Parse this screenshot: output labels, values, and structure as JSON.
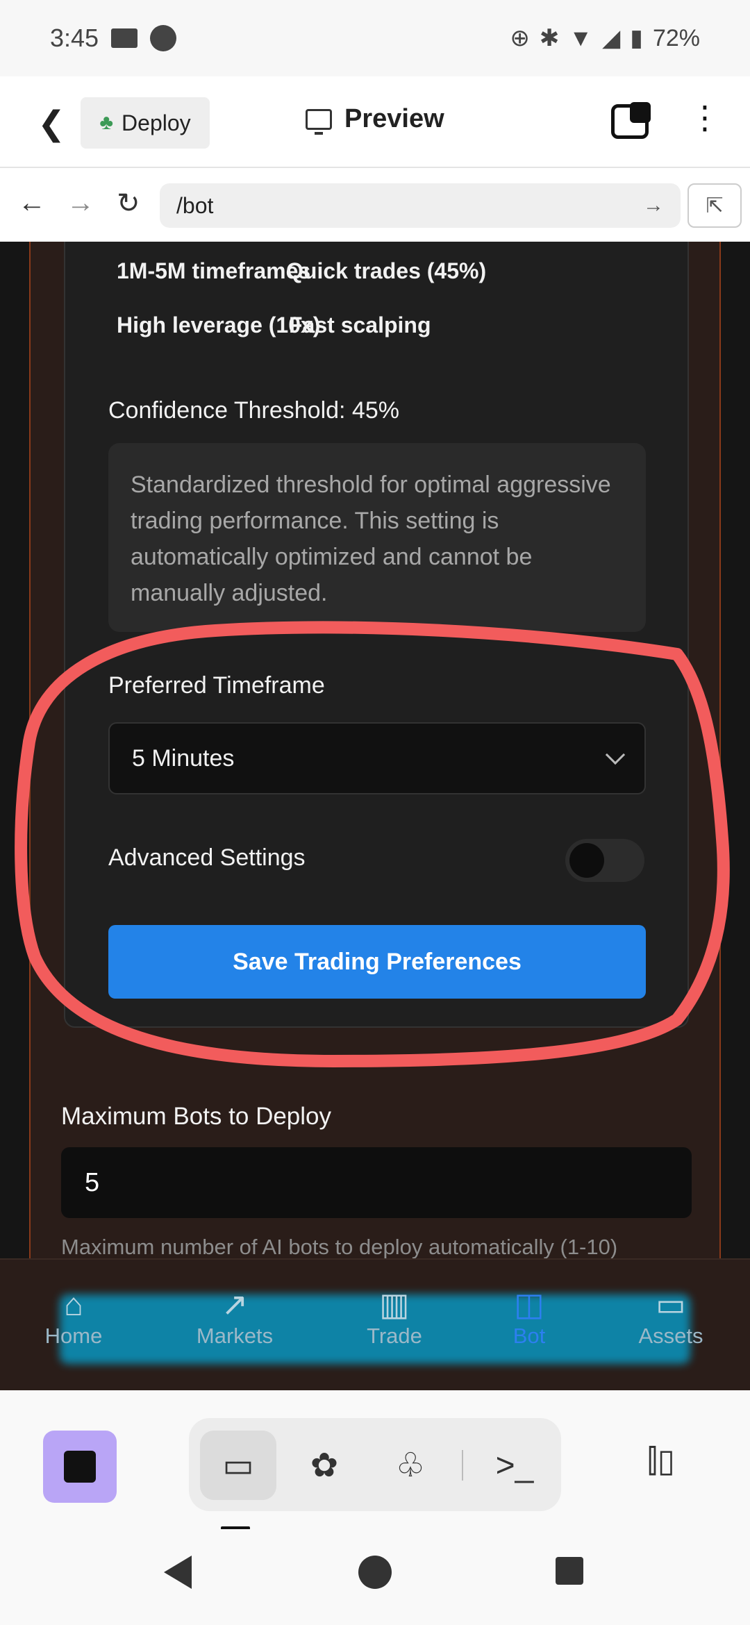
{
  "status_bar": {
    "time": "3:45",
    "battery": "72%"
  },
  "header": {
    "deploy_label": "Deploy",
    "preview_label": "Preview"
  },
  "url_bar": {
    "url": "/bot"
  },
  "card": {
    "features": [
      "1M-5M timeframes",
      "Quick trades (45%)",
      "High leverage (10x)",
      "Fast scalping"
    ],
    "confidence_label": "Confidence Threshold: 45%",
    "confidence_info": "Standardized threshold for optimal aggressive trading performance. This setting is automatically optimized and cannot be manually adjusted.",
    "timeframe_label": "Preferred Timeframe",
    "timeframe_value": "5 Minutes",
    "advanced_label": "Advanced Settings",
    "advanced_enabled": false,
    "save_label": "Save Trading Preferences"
  },
  "max_bots": {
    "label": "Maximum Bots to Deploy",
    "value": "5",
    "help": "Maximum number of AI bots to deploy automatically (1-10)"
  },
  "bottom_nav": {
    "items": [
      {
        "label": "Home",
        "icon": "home-icon"
      },
      {
        "label": "Markets",
        "icon": "trending-icon"
      },
      {
        "label": "Trade",
        "icon": "bar-chart-icon"
      },
      {
        "label": "Bot",
        "icon": "robot-icon"
      },
      {
        "label": "Assets",
        "icon": "wallet-icon"
      }
    ],
    "active": "Bot"
  },
  "colors": {
    "accent": "#2383e8",
    "annotation": "#f25c5c",
    "panel": "#2a1d19"
  }
}
